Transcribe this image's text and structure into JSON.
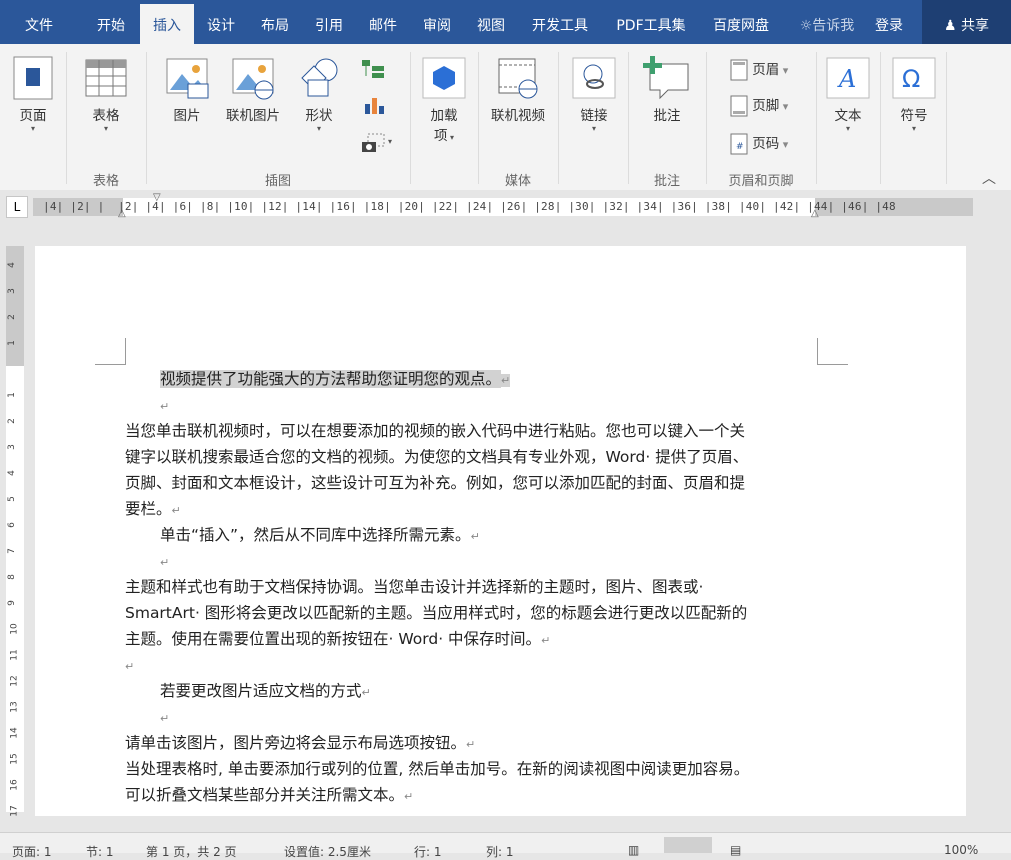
{
  "menu": {
    "file": "文件",
    "home": "开始",
    "insert": "插入",
    "design": "设计",
    "layout": "布局",
    "references": "引用",
    "mailings": "邮件",
    "review": "审阅",
    "view": "视图",
    "developer": "开发工具",
    "pdf": "PDF工具集",
    "baidu": "百度网盘",
    "tellme": "告诉我",
    "login": "登录",
    "share": "共享"
  },
  "ribbon": {
    "page": "页面",
    "table": "表格",
    "picture": "图片",
    "online_picture": "联机图片",
    "shapes": "形状",
    "addins_line1": "加载",
    "addins_line2": "项",
    "online_video": "联机视频",
    "link": "链接",
    "comment": "批注",
    "header": "页眉",
    "footer": "页脚",
    "page_number": "页码",
    "textbox": "文本",
    "symbol": "符号",
    "groups": {
      "tables": "表格",
      "illustrations": "插图",
      "media": "媒体",
      "comments": "批注",
      "header_footer": "页眉和页脚"
    }
  },
  "ruler": {
    "corner": "L",
    "h_numbers": "|4| |2| |  |2| |4| |6| |8| |10| |12| |14| |16| |18| |20| |22| |24| |26| |28| |30| |32| |34| |36| |38| |40| |42| |44| |46| |48"
  },
  "document": {
    "p1": "视频提供了功能强大的方法帮助您证明您的观点。",
    "p2_l1": "当您单击联机视频时，可以在想要添加的视频的嵌入代码中进行粘贴。您也可以键入一个关",
    "p2_l2": "键字以联机搜索最适合您的文档的视频。为使您的文档具有专业外观，Word· 提供了页眉、",
    "p2_l3": "页脚、封面和文本框设计，这些设计可互为补充。例如，您可以添加匹配的封面、页眉和提",
    "p2_l4": "要栏。",
    "p3": "单击“插入”，然后从不同库中选择所需元素。",
    "p4_l1": "主题和样式也有助于文档保持协调。当您单击设计并选择新的主题时，图片、图表或·",
    "p4_l2": "SmartArt· 图形将会更改以匹配新的主题。当应用样式时，您的标题会进行更改以匹配新的",
    "p4_l3": "主题。使用在需要位置出现的新按钮在· Word· 中保存时间。",
    "p5": "若要更改图片适应文档的方式",
    "p6": "请单击该图片，图片旁边将会显示布局选项按钮。",
    "p7_l1": "当处理表格时, 单击要添加行或列的位置, 然后单击加号。在新的阅读视图中阅读更加容易。",
    "p7_l2": "可以折叠文档某些部分并关注所需文本。",
    "para_mark": "↵"
  },
  "statusbar": {
    "page": "页面: 1",
    "section": "节: 1",
    "pages": "第 1 页，共 2 页",
    "position": "设置值: 2.5厘米",
    "line": "行: 1",
    "column": "列: 1",
    "zoom": "100%"
  },
  "colors": {
    "accent": "#2b579a",
    "ribbon_bg": "#f3f3f3",
    "highlight": "#d2d2d2"
  }
}
